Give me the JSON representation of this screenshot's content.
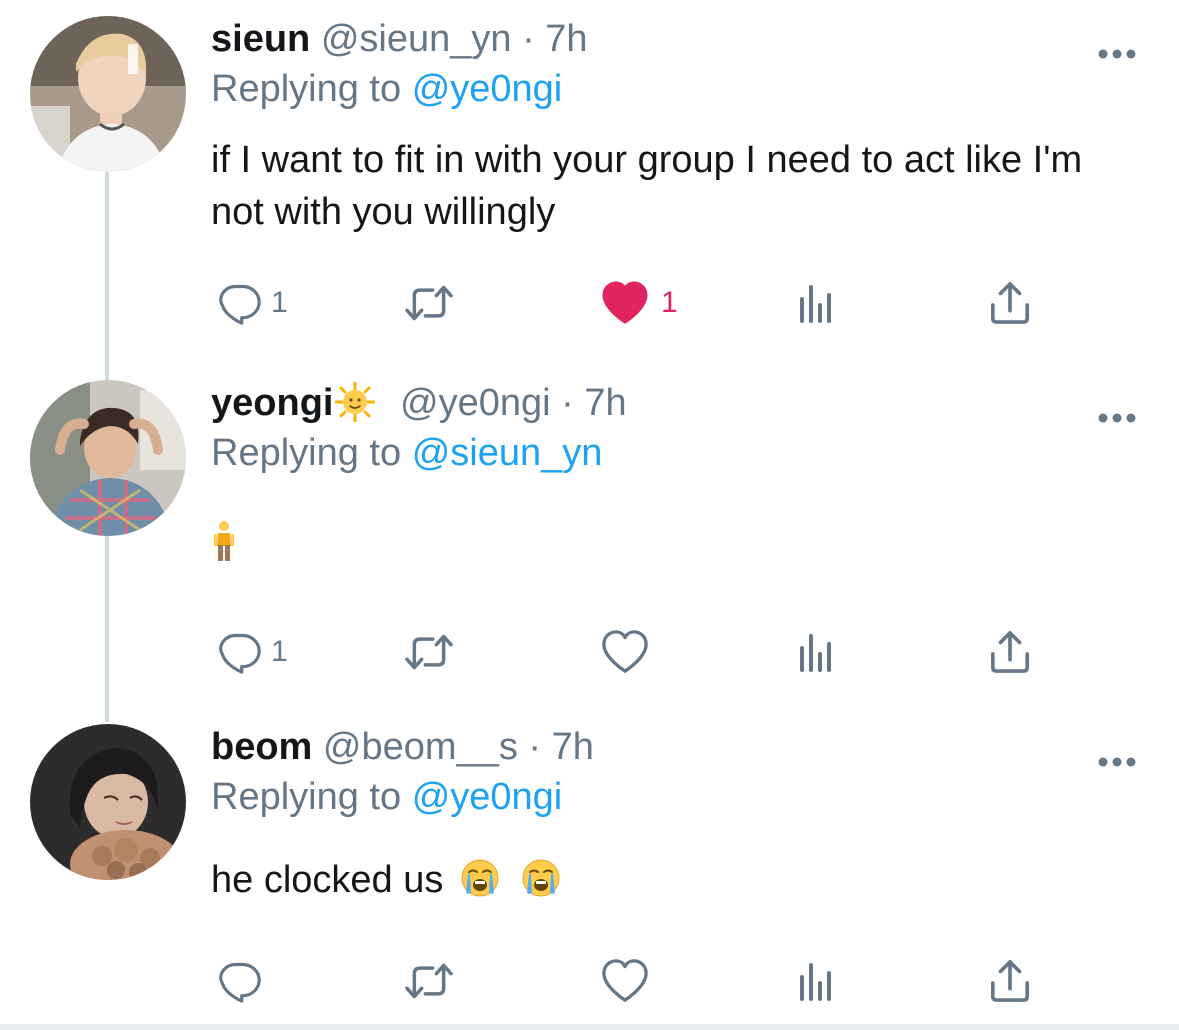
{
  "colors": {
    "name": "#14171a",
    "secondary": "#657786",
    "link": "#1da1f2",
    "like_active": "#e0245e",
    "thread_line": "#cfd9de"
  },
  "tweets": [
    {
      "name": "sieun",
      "handle": "@sieun_yn",
      "separator": "·",
      "time": "7h",
      "replying_prefix": "Replying to",
      "replying_to": "@ye0ngi",
      "text": "if I want to fit in with your group I need to act like I'm not with you willingly",
      "reply_count": "1",
      "retweet_count": "",
      "like_count": "1",
      "liked": true,
      "avatar_icon": "avatar-photo"
    },
    {
      "name": "yeongi",
      "name_emoji": "sun-with-face-icon",
      "handle": "@ye0ngi",
      "separator": "·",
      "time": "7h",
      "replying_prefix": "Replying to",
      "replying_to": "@sieun_yn",
      "text_emoji": "person-standing-icon",
      "reply_count": "1",
      "retweet_count": "",
      "like_count": "",
      "liked": false,
      "avatar_icon": "avatar-photo"
    },
    {
      "name": "beom",
      "handle": "@beom__s",
      "separator": "·",
      "time": "7h",
      "replying_prefix": "Replying to",
      "replying_to": "@ye0ngi",
      "text": "he clocked us",
      "text_emojis": [
        "loudly-crying-face-icon",
        "loudly-crying-face-icon"
      ],
      "reply_count": "",
      "retweet_count": "",
      "like_count": "",
      "liked": false,
      "avatar_icon": "avatar-photo"
    }
  ]
}
